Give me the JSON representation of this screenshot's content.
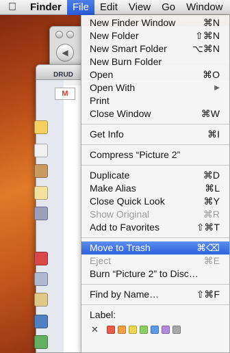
{
  "menubar": {
    "apple_icon": "apple-icon",
    "items": [
      "Finder",
      "File",
      "Edit",
      "View",
      "Go",
      "Window"
    ]
  },
  "background": {
    "window_title_fragment": "DRUD",
    "gmail_label": "M"
  },
  "file_menu": {
    "group1": [
      {
        "label": "New Finder Window",
        "shortcut": "⌘N",
        "enabled": true
      },
      {
        "label": "New Folder",
        "shortcut": "⇧⌘N",
        "enabled": true
      },
      {
        "label": "New Smart Folder",
        "shortcut": "⌥⌘N",
        "enabled": true
      },
      {
        "label": "New Burn Folder",
        "shortcut": "",
        "enabled": true
      },
      {
        "label": "Open",
        "shortcut": "⌘O",
        "enabled": true
      },
      {
        "label": "Open With",
        "shortcut": "▶",
        "enabled": true
      },
      {
        "label": "Print",
        "shortcut": "",
        "enabled": true
      },
      {
        "label": "Close Window",
        "shortcut": "⌘W",
        "enabled": true
      }
    ],
    "group2": [
      {
        "label": "Get Info",
        "shortcut": "⌘I",
        "enabled": true
      }
    ],
    "group3": [
      {
        "label": "Compress “Picture 2”",
        "shortcut": "",
        "enabled": true
      }
    ],
    "group4": [
      {
        "label": "Duplicate",
        "shortcut": "⌘D",
        "enabled": true
      },
      {
        "label": "Make Alias",
        "shortcut": "⌘L",
        "enabled": true
      },
      {
        "label": "Close Quick Look",
        "shortcut": "⌘Y",
        "enabled": true
      },
      {
        "label": "Show Original",
        "shortcut": "⌘R",
        "enabled": false
      },
      {
        "label": "Add to Favorites",
        "shortcut": "⇧⌘T",
        "enabled": true
      }
    ],
    "group5": [
      {
        "label": "Move to Trash",
        "shortcut": "⌘⌫",
        "enabled": true,
        "highlighted": true
      },
      {
        "label": "Eject",
        "shortcut": "⌘E",
        "enabled": false
      },
      {
        "label": "Burn “Picture 2” to Disc…",
        "shortcut": "",
        "enabled": true
      }
    ],
    "group6": [
      {
        "label": "Find by Name…",
        "shortcut": "⇧⌘F",
        "enabled": true
      }
    ],
    "label_section": {
      "title": "Label:",
      "clear_symbol": "✕",
      "colors": [
        "#e85a4a",
        "#f0a040",
        "#e8d84a",
        "#8cd060",
        "#5a9ae8",
        "#b48ad8",
        "#a8a8a8"
      ]
    }
  }
}
